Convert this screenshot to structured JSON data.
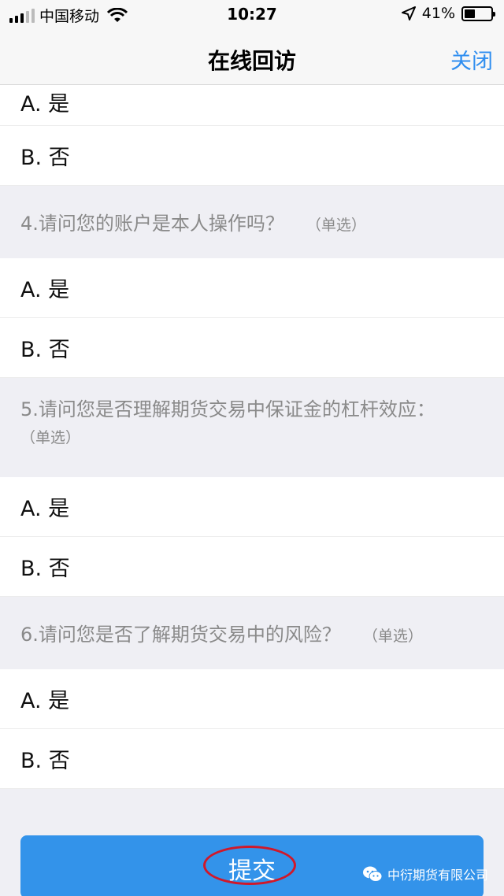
{
  "status_bar": {
    "carrier": "中国移动",
    "time": "10:27",
    "battery_percent": "41%",
    "battery_level": 0.41
  },
  "nav": {
    "title": "在线回访",
    "close_label": "关闭"
  },
  "partial_option": "A. 是",
  "q3_option_b": "B. 否",
  "questions": [
    {
      "text": "4.请问您的账户是本人操作吗？",
      "type": "（单选）",
      "options": [
        "A. 是",
        "B. 否"
      ]
    },
    {
      "text": "5.请问您是否理解期货交易中保证金的杠杆效应：",
      "type": "（单选）",
      "options": [
        "A. 是",
        "B. 否"
      ]
    },
    {
      "text": "6.请问您是否了解期货交易中的风险？",
      "type": "（单选）",
      "options": [
        "A. 是",
        "B. 否"
      ]
    }
  ],
  "submit_label": "提交",
  "watermark": "中衍期货有限公司",
  "colors": {
    "accent": "#3393ea",
    "link": "#2f8ef0",
    "annotation": "#d0182a"
  }
}
